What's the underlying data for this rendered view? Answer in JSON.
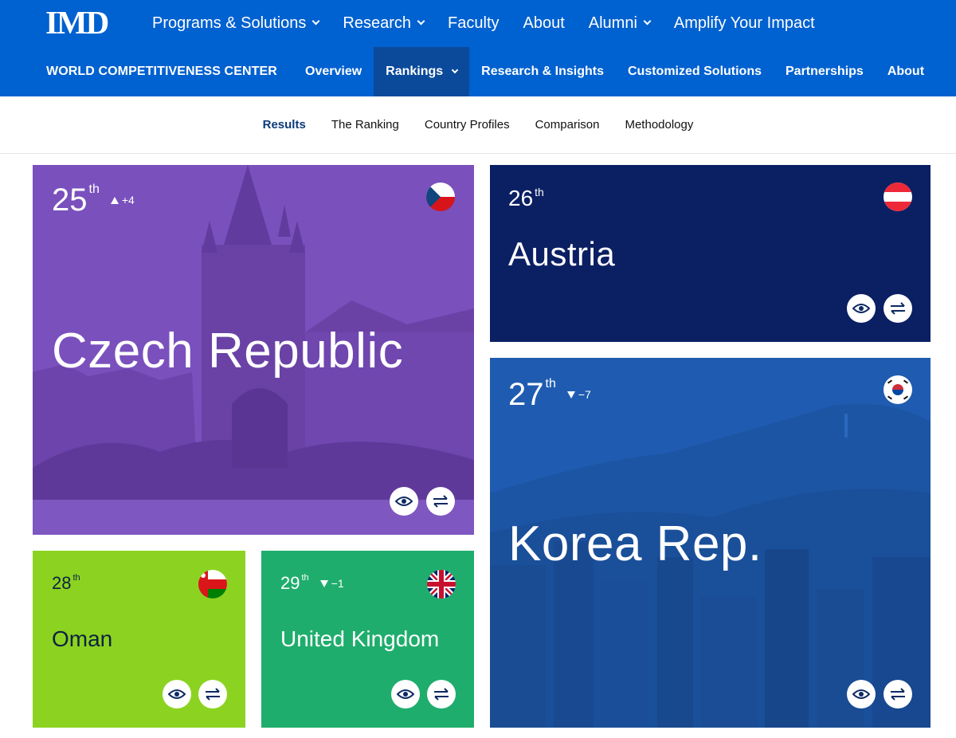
{
  "header": {
    "logo": "IMD",
    "main_nav": [
      {
        "label": "Programs & Solutions",
        "dropdown": true
      },
      {
        "label": "Research",
        "dropdown": true
      },
      {
        "label": "Faculty",
        "dropdown": false
      },
      {
        "label": "About",
        "dropdown": false
      },
      {
        "label": "Alumni",
        "dropdown": true
      },
      {
        "label": "Amplify Your Impact",
        "dropdown": false
      }
    ],
    "center_name": "WORLD COMPETITIVENESS CENTER",
    "sub_nav": [
      {
        "label": "Overview"
      },
      {
        "label": "Rankings",
        "active": true
      },
      {
        "label": "Research & Insights"
      },
      {
        "label": "Customized Solutions"
      },
      {
        "label": "Partnerships"
      },
      {
        "label": "About"
      }
    ]
  },
  "tabs": [
    {
      "label": "Results",
      "active": true
    },
    {
      "label": "The Ranking"
    },
    {
      "label": "Country Profiles"
    },
    {
      "label": "Comparison"
    },
    {
      "label": "Methodology"
    }
  ],
  "cards": [
    {
      "rank": "25",
      "suffix": "th",
      "change": "+4",
      "direction": "up",
      "country": "Czech Republic",
      "flag": "czech-flag-icon",
      "color": "#7a50bd"
    },
    {
      "rank": "26",
      "suffix": "th",
      "change": "",
      "direction": "",
      "country": "Austria",
      "flag": "austria-flag-icon",
      "color": "#0b1f63"
    },
    {
      "rank": "27",
      "suffix": "th",
      "change": "−7",
      "direction": "down",
      "country": "Korea Rep.",
      "flag": "korea-flag-icon",
      "color": "#1f5cb1"
    },
    {
      "rank": "28",
      "suffix": "th",
      "change": "",
      "direction": "",
      "country": "Oman",
      "flag": "oman-flag-icon",
      "color": "#8cd321"
    },
    {
      "rank": "29",
      "suffix": "th",
      "change": "−1",
      "direction": "down",
      "country": "United Kingdom",
      "flag": "uk-flag-icon",
      "color": "#1fad6d"
    }
  ],
  "icons": {
    "view": "eye-icon",
    "compare": "swap-arrows-icon"
  },
  "colors": {
    "brand_blue": "#0061d0",
    "active_subnav": "#0b4a9b",
    "icon_navy": "#0d2a63"
  }
}
